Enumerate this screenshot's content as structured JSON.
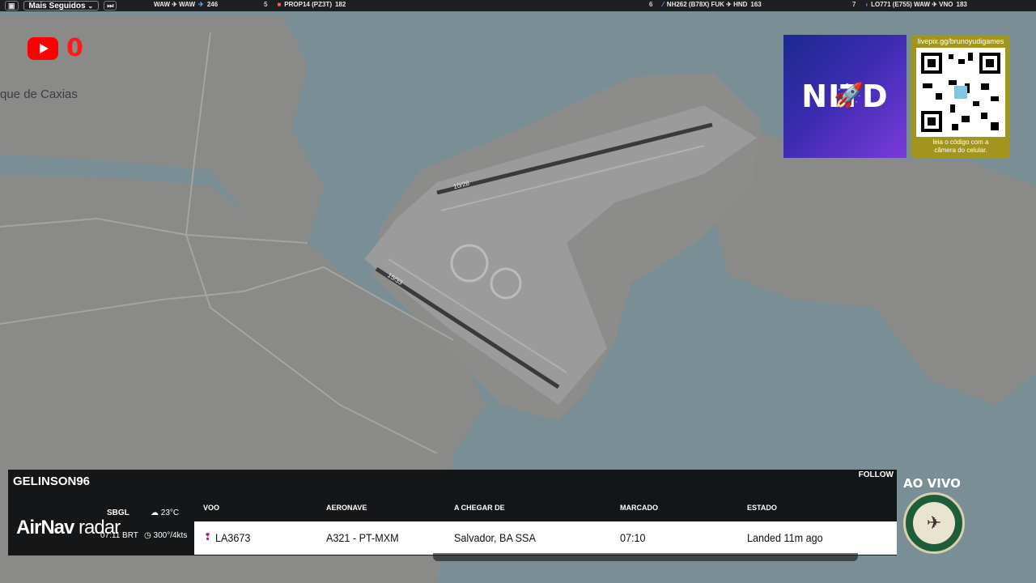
{
  "topbar": {
    "dropdown_label": "Mais Seguidos",
    "items": [
      {
        "route": "WAW ✈ WAW",
        "count": "246"
      },
      {
        "rank": "5",
        "flight": "PROP14 (PZ3T)",
        "count": "182"
      },
      {
        "rank": "6",
        "flight": "NH262 (B78X) FUK ✈ HND",
        "count": "163"
      },
      {
        "rank": "7",
        "flight": "LO771 (E755) WAW ✈ VNO",
        "count": "183"
      }
    ]
  },
  "youtube": {
    "count": "0"
  },
  "map": {
    "place_label": "que de Caxias",
    "runway_1": "10/28",
    "runway_2": "15/33"
  },
  "sponsor": {
    "logo_text": "NITD"
  },
  "qr": {
    "url": "livepix.gg/brunoyudigames",
    "caption_1": "leia o código com a",
    "caption_2": "câmera do celular."
  },
  "panel": {
    "username": "GELINSON96",
    "follow": "FOLLOW",
    "brand_1": "AirNav",
    "brand_2": "radar",
    "airport": "SBGL",
    "time": "07:11 BRT",
    "temp": "23°C",
    "wind": "300°/4kts",
    "headers": {
      "flight": "VOO",
      "aircraft": "AERONAVE",
      "from": "A CHEGAR DE",
      "scheduled": "MARCADO",
      "status": "ESTADO"
    },
    "row": {
      "flight": "LA3673",
      "aircraft": "A321 - PT-MXM",
      "from": "Salvador, BA SSA",
      "scheduled": "07:10",
      "status": "Landed 11m ago"
    }
  },
  "live": {
    "label": "AO VIVO"
  }
}
